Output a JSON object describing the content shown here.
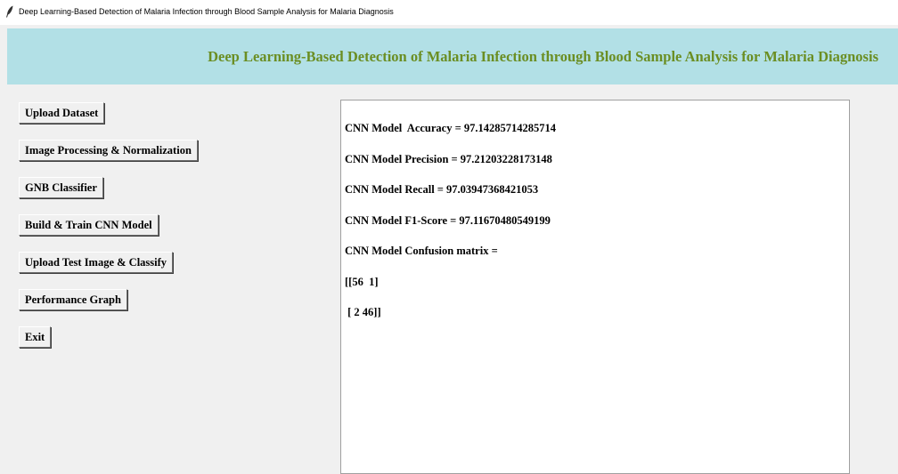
{
  "window": {
    "title": "Deep Learning-Based Detection of Malaria Infection through Blood Sample Analysis for Malaria Diagnosis",
    "icon": "feather-icon"
  },
  "header": {
    "heading": "Deep Learning-Based Detection of Malaria Infection through Blood Sample Analysis for Malaria Diagnosis",
    "background": "#b2e0e6",
    "text_color": "#6b8e23"
  },
  "buttons": {
    "upload_dataset": "Upload Dataset",
    "image_processing": "Image Processing & Normalization",
    "gnb_classifier": "GNB Classifier",
    "build_train_cnn": "Build & Train CNN Model",
    "upload_test_image": "Upload Test Image & Classify",
    "performance_graph": "Performance Graph",
    "exit": "Exit"
  },
  "output": {
    "lines": [
      "CNN Model  Accuracy = 97.14285714285714",
      "CNN Model Precision = 97.21203228173148",
      "CNN Model Recall = 97.03947368421053",
      "CNN Model F1-Score = 97.11670480549199",
      "CNN Model Confusion matrix =",
      "[[56  1]",
      " [ 2 46]]"
    ]
  }
}
